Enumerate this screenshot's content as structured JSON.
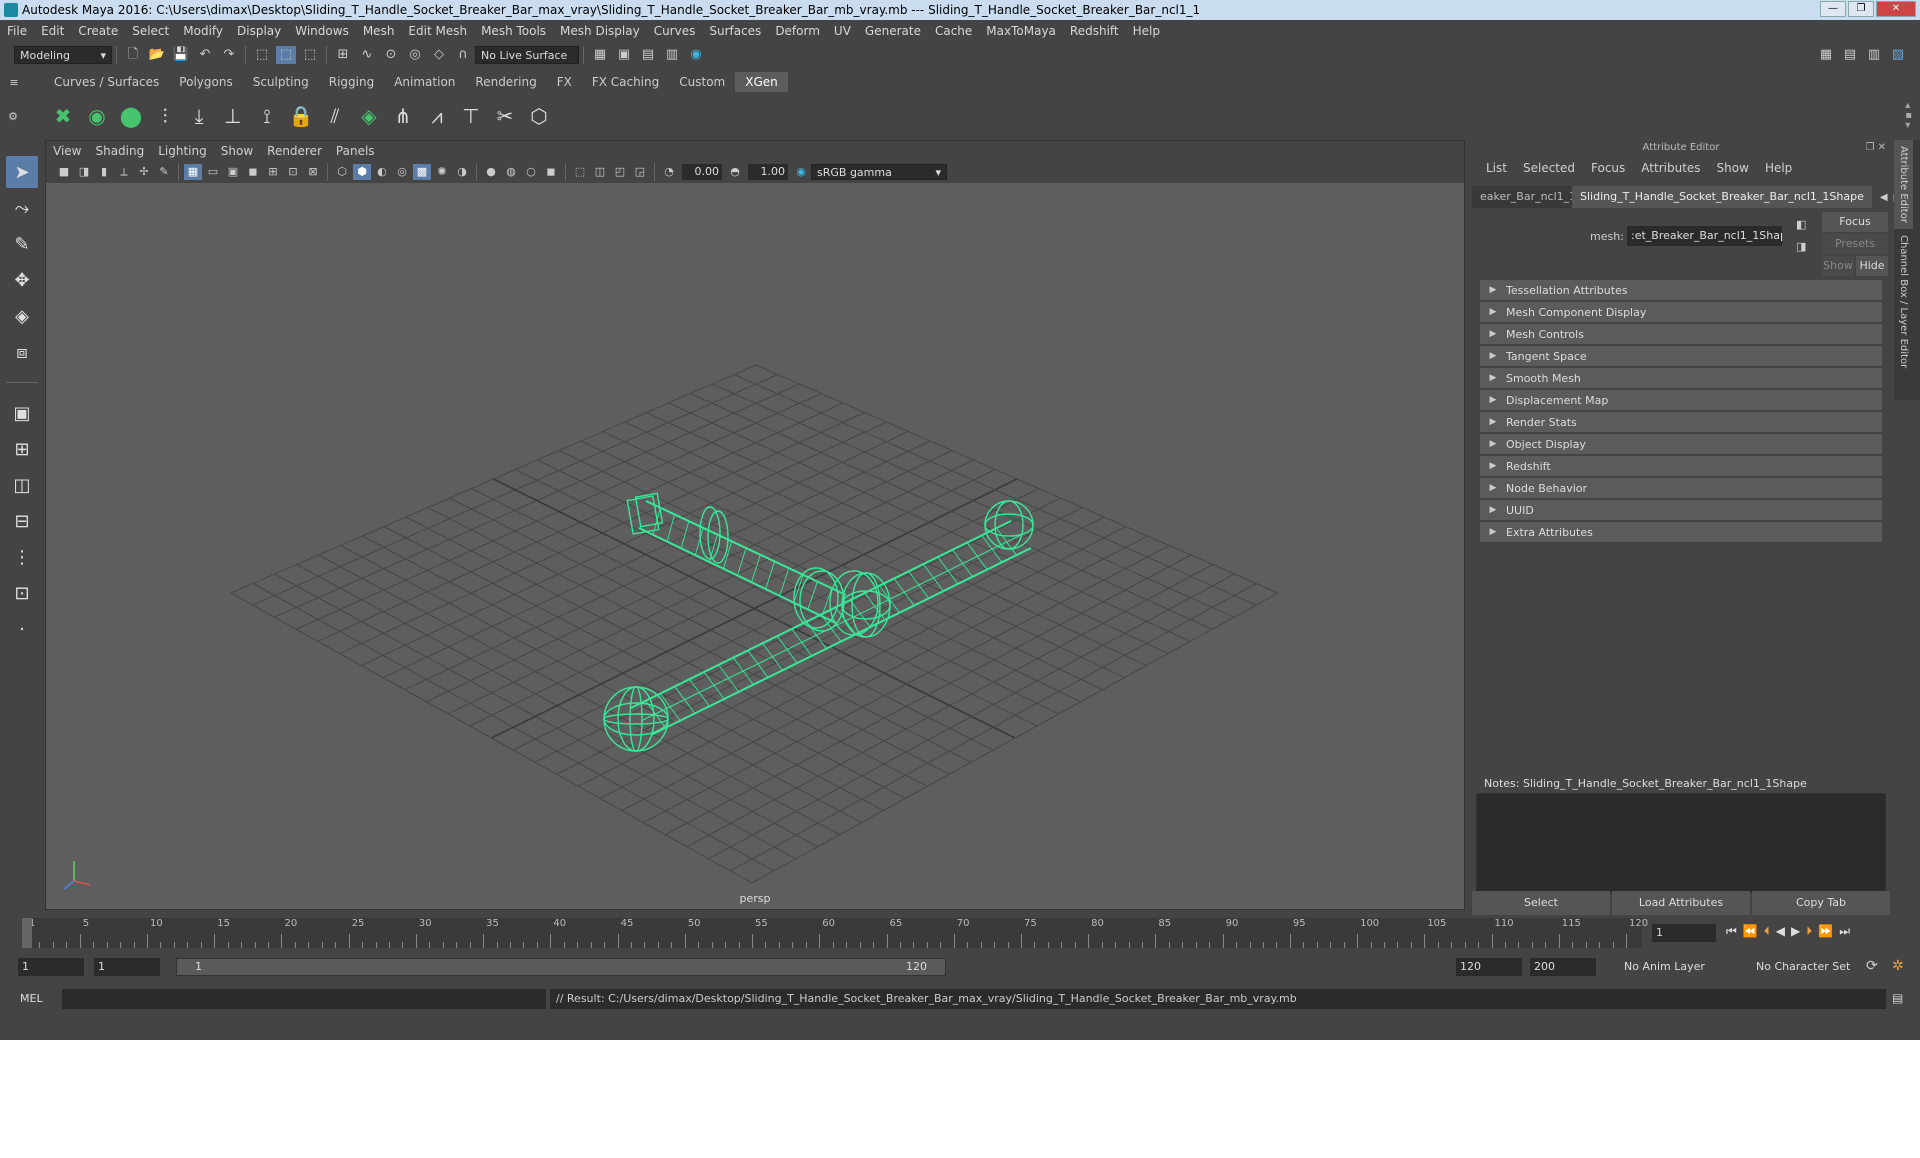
{
  "window": {
    "title": "Autodesk Maya 2016: C:\\Users\\dimax\\Desktop\\Sliding_T_Handle_Socket_Breaker_Bar_max_vray\\Sliding_T_Handle_Socket_Breaker_Bar_mb_vray.mb   ---   Sliding_T_Handle_Socket_Breaker_Bar_ncl1_1"
  },
  "menubar": [
    "File",
    "Edit",
    "Create",
    "Select",
    "Modify",
    "Display",
    "Windows",
    "Mesh",
    "Edit Mesh",
    "Mesh Tools",
    "Mesh Display",
    "Curves",
    "Surfaces",
    "Deform",
    "UV",
    "Generate",
    "Cache",
    "MaxToMaya",
    "Redshift",
    "Help"
  ],
  "statusline": {
    "mode": "Modeling",
    "live_surface": "No Live Surface"
  },
  "shelf_tabs": [
    "Curves / Surfaces",
    "Polygons",
    "Sculpting",
    "Rigging",
    "Animation",
    "Rendering",
    "FX",
    "FX Caching",
    "Custom",
    "XGen"
  ],
  "active_shelf_tab": "XGen",
  "viewport": {
    "menu": [
      "View",
      "Shading",
      "Lighting",
      "Show",
      "Renderer",
      "Panels"
    ],
    "exposure": "0.00",
    "gamma": "1.00",
    "color_space": "sRGB gamma",
    "camera": "persp"
  },
  "attribute_editor": {
    "header": "Attribute Editor",
    "menu": [
      "List",
      "Selected",
      "Focus",
      "Attributes",
      "Show",
      "Help"
    ],
    "node_tabs": [
      "eaker_Bar_ncl1_1",
      "Sliding_T_Handle_Socket_Breaker_Bar_ncl1_1Shape"
    ],
    "mesh_label": "mesh:",
    "mesh_value": ":et_Breaker_Bar_ncl1_1Shape",
    "focus": "Focus",
    "presets": "Presets",
    "show": "Show",
    "hide": "Hide",
    "sections": [
      "Tessellation Attributes",
      "Mesh Component Display",
      "Mesh Controls",
      "Tangent Space",
      "Smooth Mesh",
      "Displacement Map",
      "Render Stats",
      "Object Display",
      "Redshift",
      "Node Behavior",
      "UUID",
      "Extra Attributes"
    ],
    "notes_label": "Notes:  Sliding_T_Handle_Socket_Breaker_Bar_ncl1_1Shape",
    "buttons": [
      "Select",
      "Load Attributes",
      "Copy Tab"
    ]
  },
  "side_tabs": [
    "Attribute Editor",
    "Channel Box / Layer Editor"
  ],
  "timeline": {
    "ticks": [
      "1",
      "5",
      "10",
      "15",
      "20",
      "25",
      "30",
      "35",
      "40",
      "45",
      "50",
      "55",
      "60",
      "65",
      "70",
      "75",
      "80",
      "85",
      "90",
      "95",
      "100",
      "105",
      "110",
      "115",
      "120"
    ],
    "current_frame": "1"
  },
  "range": {
    "start": "1",
    "playback_start": "1",
    "range_start_label": "1",
    "range_end_label": "120",
    "playback_end": "120",
    "end": "200",
    "anim_layer": "No Anim Layer",
    "char_set": "No Character Set"
  },
  "command": {
    "lang": "MEL",
    "result": "// Result: C:/Users/dimax/Desktop/Sliding_T_Handle_Socket_Breaker_Bar_max_vray/Sliding_T_Handle_Socket_Breaker_Bar_mb_vray.mb"
  },
  "colors": {
    "wireframe": "#37e898",
    "selected_highlight": "#5b7ea8",
    "panel": "#444444",
    "viewport_bg": "#5e5e5e"
  }
}
